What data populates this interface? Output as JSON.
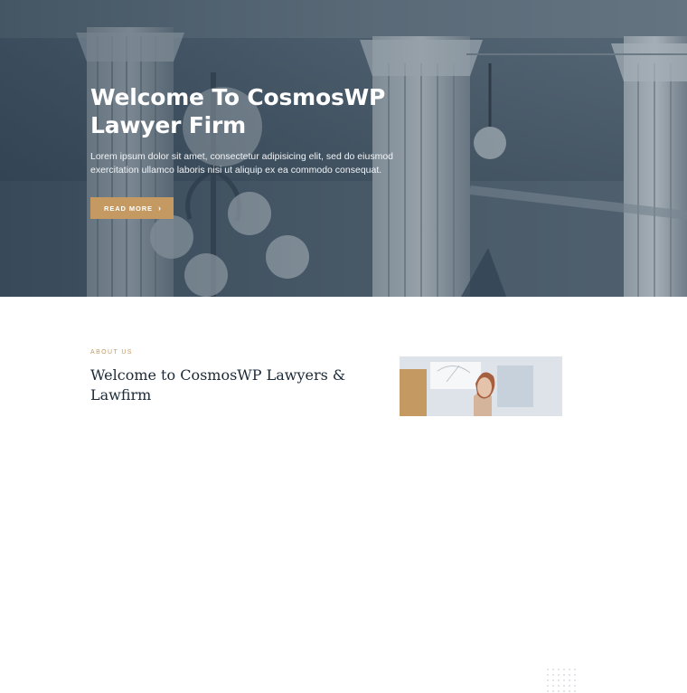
{
  "hero": {
    "title_line1": "Welcome To CosmosWP",
    "title_line2": "Lawyer Firm",
    "text": "Lorem ipsum dolor sit amet, consectetur adipisicing elit, sed do eiusmod exercitation ullamco laboris nisi ut aliquip ex ea commodo consequat.",
    "button_label": "READ MORE",
    "button_icon": "chevron-right-icon",
    "button_color": "#c49a62"
  },
  "about": {
    "eyebrow": "ABOUT US",
    "title": "Welcome to CosmosWP Lawyers & Lawfirm",
    "accent_color": "#c49a62"
  }
}
